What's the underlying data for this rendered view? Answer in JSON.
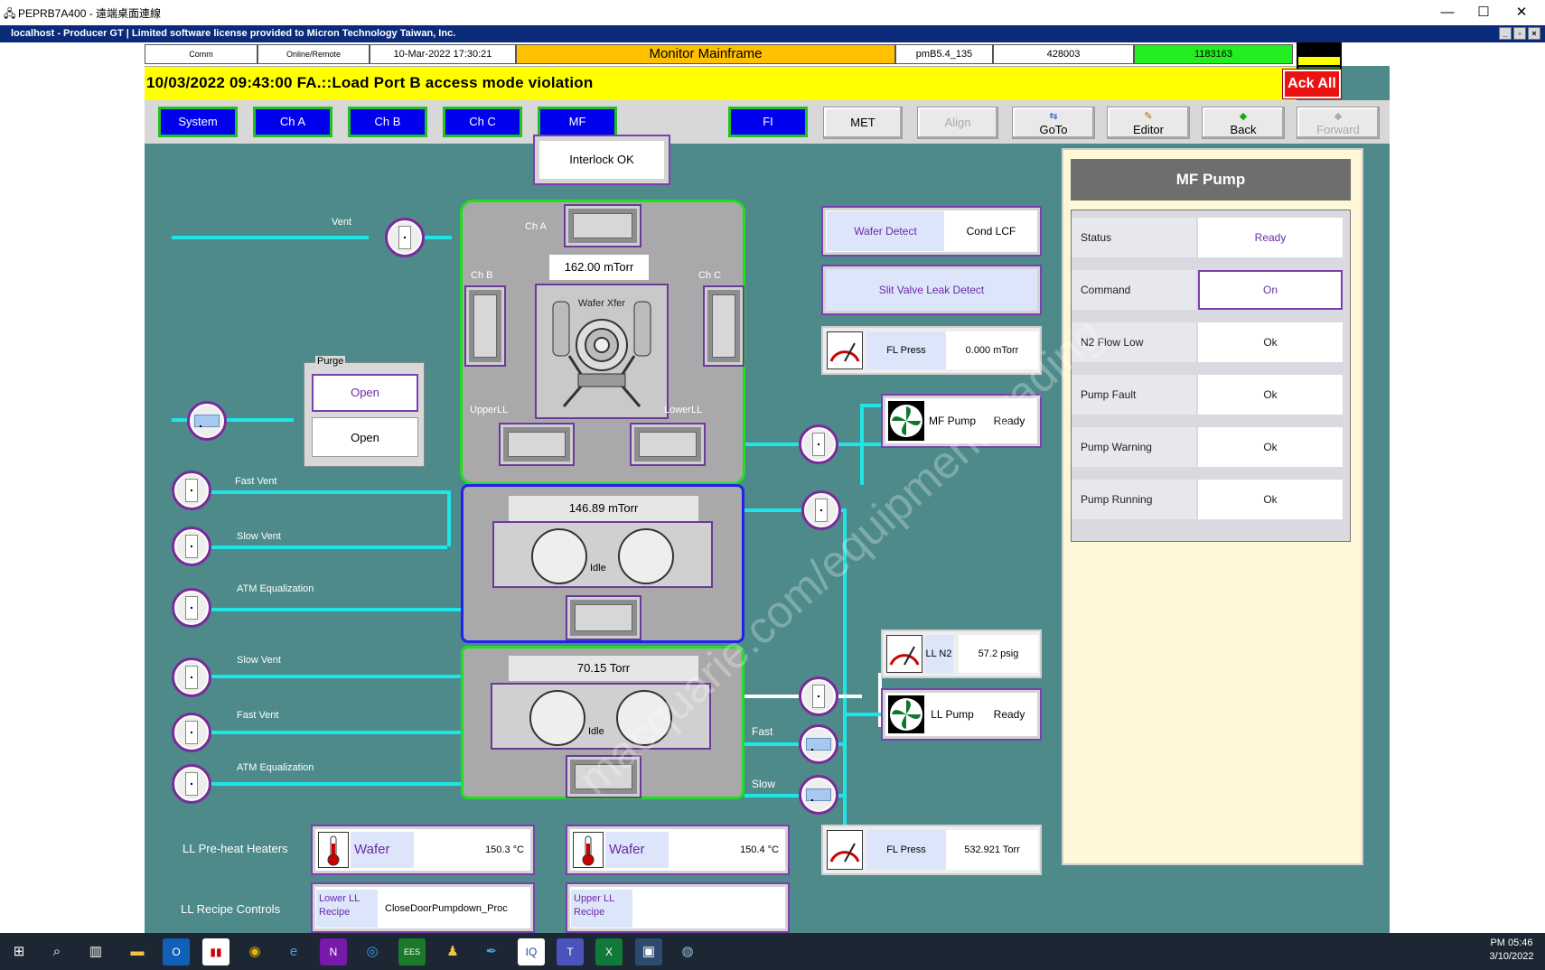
{
  "window": {
    "title": "PEPRB7A400 - 遠端桌面連線",
    "rdp_title": "localhost - Producer GT | Limited software license provided to Micron Technology Taiwan, Inc.",
    "minimize": "—",
    "maximize": "☐",
    "close": "✕"
  },
  "header": {
    "comm": "Comm",
    "mode": "Online/Remote",
    "datetime": "10-Mar-2022 17:30:21",
    "screen": "Monitor Mainframe",
    "version": "pmB5.4_135",
    "code1": "428003",
    "code2": "1183163",
    "screen_color": "#ffc000",
    "code2_color": "#22ee22"
  },
  "alarm": {
    "message": "10/03/2022 09:43:00 FA.::Load Port B access mode violation",
    "ack_all": "Ack All"
  },
  "nav": {
    "system": "System",
    "cha": "Ch A",
    "chb": "Ch B",
    "chc": "Ch C",
    "mf": "MF",
    "fi": "FI",
    "met": "MET",
    "align": "Align",
    "goto": "GoTo",
    "editor": "Editor",
    "back": "Back",
    "forward": "Forward"
  },
  "mainframe": {
    "interlock": "Interlock OK",
    "vent": "Vent",
    "cha": "Ch A",
    "chb": "Ch B",
    "chc": "Ch C",
    "tm_pressure": "162.00 mTorr",
    "waferxfer": "Wafer Xfer",
    "upperll": "UpperLL",
    "lowerll": "LowerLL",
    "purge": {
      "title": "Purge",
      "btn1": "Open",
      "btn2": "Open"
    },
    "upper_ll": {
      "pressure": "146.89 mTorr",
      "state": "Idle"
    },
    "lower_ll": {
      "pressure": "70.15 Torr",
      "state": "Idle"
    },
    "fast_vent": "Fast Vent",
    "slow_vent": "Slow Vent",
    "atm_eq": "ATM Equalization",
    "fast": "Fast",
    "slow": "Slow"
  },
  "sensors": {
    "wafer_detect": "Wafer Detect",
    "cond_lcf": "Cond LCF",
    "slit_valve": "Slit Valve Leak Detect",
    "fl_press_1": {
      "label": "FL Press",
      "value": "0.000 mTorr"
    },
    "mf_pump": {
      "label": "MF Pump",
      "value": "Ready"
    },
    "ll_n2": {
      "label": "LL N2",
      "value": "57.2 psig"
    },
    "ll_pump": {
      "label": "LL Pump",
      "value": "Ready"
    },
    "fl_press_2": {
      "label": "FL Press",
      "value": "532.921 Torr"
    }
  },
  "heaters": {
    "label": "LL Pre-heat Heaters",
    "h1": {
      "name": "Wafer",
      "value": "150.3 °C"
    },
    "h2": {
      "name": "Wafer",
      "value": "150.4 °C"
    }
  },
  "recipes": {
    "label": "LL Recipe Controls",
    "lower_label": "Lower LL Recipe",
    "lower_value": "CloseDoorPumpdown_Proc",
    "upper_label": "Upper LL Recipe",
    "upper_value": ""
  },
  "mf_pump_panel": {
    "title": "MF Pump",
    "rows": [
      {
        "key": "Status",
        "value": "Ready"
      },
      {
        "key": "Command",
        "value": "On"
      },
      {
        "key": "N2 Flow Low",
        "value": "Ok"
      },
      {
        "key": "Pump Fault",
        "value": "Ok"
      },
      {
        "key": "Pump Warning",
        "value": "Ok"
      },
      {
        "key": "Pump Running",
        "value": "Ok"
      }
    ]
  },
  "watermark": "macquarie.com/equipment-trading",
  "clock": {
    "time": "PM 05:46",
    "date": "3/10/2022"
  }
}
